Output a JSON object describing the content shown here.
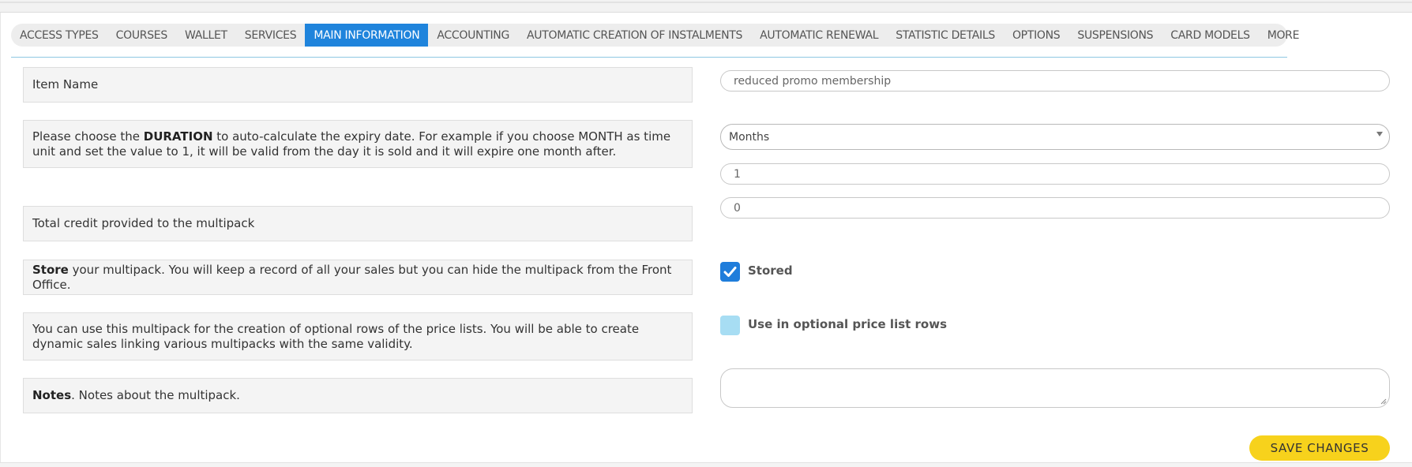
{
  "tabs": [
    {
      "label": "ACCESS TYPES",
      "active": false
    },
    {
      "label": "COURSES",
      "active": false
    },
    {
      "label": "WALLET",
      "active": false
    },
    {
      "label": "SERVICES",
      "active": false
    },
    {
      "label": "MAIN INFORMATION",
      "active": true
    },
    {
      "label": "ACCOUNTING",
      "active": false
    },
    {
      "label": "AUTOMATIC CREATION OF INSTALMENTS",
      "active": false
    },
    {
      "label": "AUTOMATIC RENEWAL",
      "active": false
    },
    {
      "label": "STATISTIC DETAILS",
      "active": false
    },
    {
      "label": "OPTIONS",
      "active": false
    },
    {
      "label": "SUSPENSIONS",
      "active": false
    },
    {
      "label": "CARD MODELS",
      "active": false
    },
    {
      "label": "MORE",
      "active": false
    }
  ],
  "form": {
    "item_name": {
      "label": "Item Name",
      "value": "reduced promo membership"
    },
    "duration": {
      "label_pre": "Please choose the ",
      "label_bold": "DURATION",
      "label_post": " to auto-calculate the expiry date. For example if you choose MONTH as time unit and set the value to 1, it will be valid from the day it is sold and it will expire one month after.",
      "unit_selected": "Months",
      "value": "1"
    },
    "total_credit": {
      "label": "Total credit provided to the multipack",
      "value": "0"
    },
    "store": {
      "label_bold": "Store",
      "label_post": " your multipack. You will keep a record of all your sales but you can hide the multipack from the Front Office.",
      "checkbox_label": "Stored",
      "checked": true
    },
    "optional_rows": {
      "label": "You can use this multipack for the creation of optional rows of the price lists. You will be able to create dynamic sales linking various multipacks with the same validity.",
      "checkbox_label": "Use in optional price list rows",
      "checked": false
    },
    "notes": {
      "label_bold": "Notes",
      "label_post": ". Notes about the multipack.",
      "value": ""
    }
  },
  "save_button": {
    "label": "SAVE CHANGES"
  },
  "colors": {
    "accent_blue": "#1f84dc",
    "checkbox_checked": "#1f7ddb",
    "checkbox_unchecked": "#a7ddf3",
    "save_button": "#f7d21c"
  }
}
